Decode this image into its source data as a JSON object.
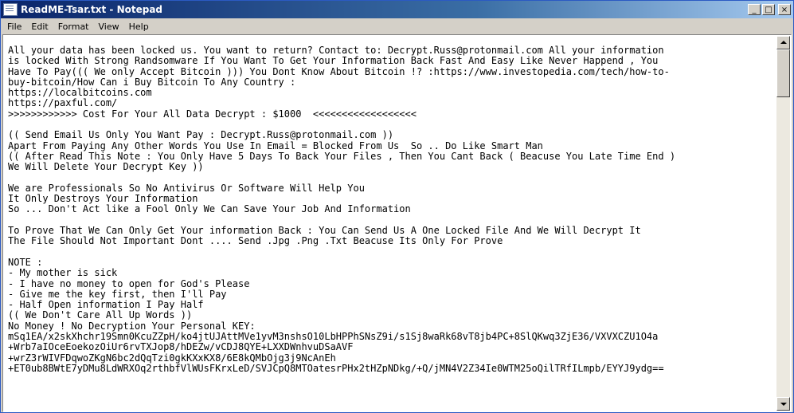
{
  "window": {
    "title": "ReadME-Tsar.txt - Notepad",
    "minimize_label": "_",
    "maximize_label": "□",
    "close_label": "×"
  },
  "menu": {
    "items": [
      "File",
      "Edit",
      "Format",
      "View",
      "Help"
    ]
  },
  "document": {
    "lines": [
      "All your data has been locked us. You want to return? Contact to: Decrypt.Russ@protonmail.com All your information",
      "is locked With Strong Randsomware If You Want To Get Your Information Back Fast And Easy Like Never Happend , You",
      "Have To Pay((( We only Accept Bitcoin ))) You Dont Know About Bitcoin !? :https://www.investopedia.com/tech/how-to-",
      "buy-bitcoin/How Can i Buy Bitcoin To Any Country :",
      "https://localbitcoins.com",
      "https://paxful.com/",
      ">>>>>>>>>>>> Cost For Your All Data Decrypt : $1000  <<<<<<<<<<<<<<<<<<",
      "",
      "(( Send Email Us Only You Want Pay : Decrypt.Russ@protonmail.com ))",
      "Apart From Paying Any Other Words You Use In Email = Blocked From Us  So .. Do Like Smart Man",
      "(( After Read This Note : You Only Have 5 Days To Back Your Files , Then You Cant Back ( Beacuse You Late Time End )",
      "We Will Delete Your Decrypt Key ))",
      "",
      "We are Professionals So No Antivirus Or Software Will Help You",
      "It Only Destroys Your Information",
      "So ... Don't Act like a Fool Only We Can Save Your Job And Information",
      "",
      "To Prove That We Can Only Get Your information Back : You Can Send Us A One Locked File And We Will Decrypt It",
      "The File Should Not Important Dont .... Send .Jpg .Png .Txt Beacuse Its Only For Prove",
      "",
      "NOTE :",
      "- My mother is sick",
      "- I have no money to open for God's Please",
      "- Give me the key first, then I'll Pay",
      "- Half Open information I Pay Half",
      "(( We Don't Care All Up Words ))",
      "No Money ! No Decryption Your Personal KEY:",
      "mSq1EA/x2skXhchr19Smn0KcuZZpH/ko4jtUJAttMVe1yvM3nshsO10LbHPPhSNsZ9i/s1Sj8waRk68vT8jb4PC+8SlQKwq3ZjE36/VXVXCZU1O4a",
      "+Wrb7aIOceEoekozOiUr6rvTXJop8/hDEZw/vCDJ8QYE+LXXDWnhvuDSaAVF",
      "+wrZ3rWIVFDqwoZKgN6bc2dQqTzi0gkKXxKX8/6E8kQMbOjg3j9NcAnEh",
      "+ET0ub8BWtE7yDMu8LdWRXOq2rthbfVlWUsFKrxLeD/SVJCpQ8MTOatesrPHx2tHZpNDkg/+Q/jMN4V2Z34Ie0WTM25oQilTRfILmpb/EYYJ9ydg=="
    ]
  }
}
